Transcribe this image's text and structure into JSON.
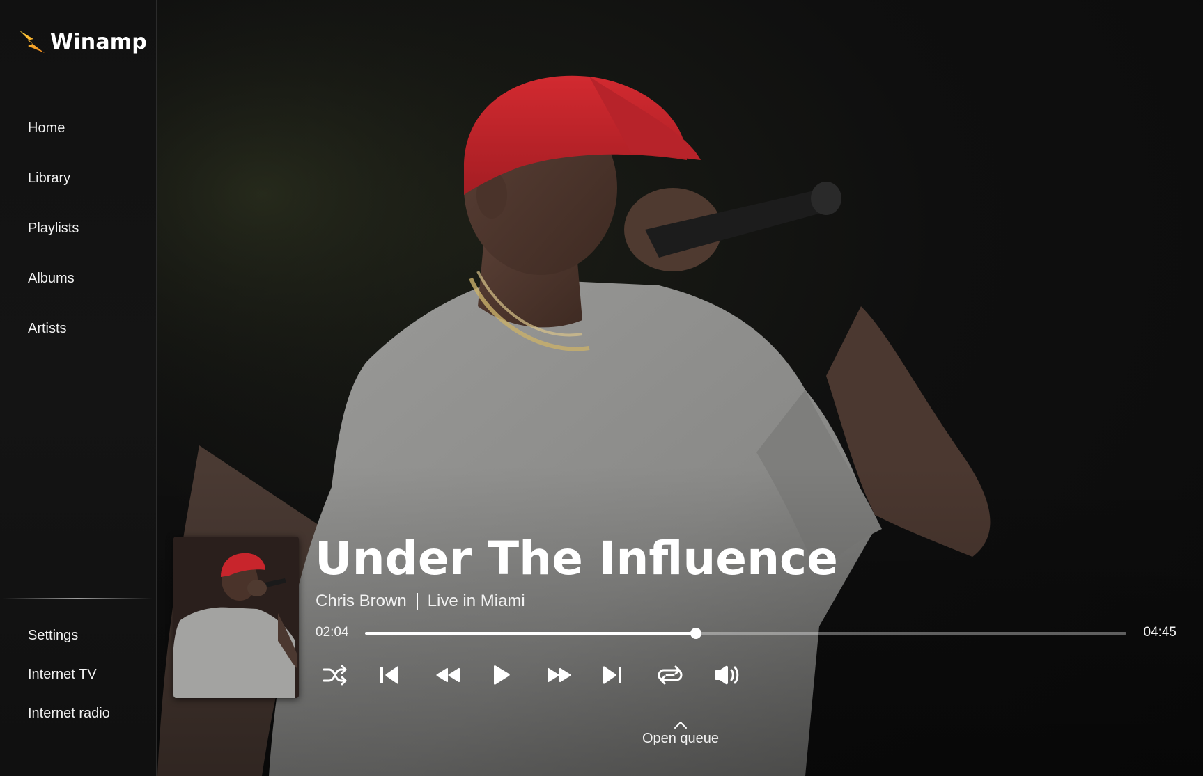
{
  "app": {
    "name": "Winamp"
  },
  "sidebar": {
    "primary": [
      {
        "label": "Home",
        "icon": "home"
      },
      {
        "label": "Library",
        "icon": "library"
      },
      {
        "label": "Playlists",
        "icon": "playlists"
      },
      {
        "label": "Albums",
        "icon": "albums"
      },
      {
        "label": "Artists",
        "icon": "artists"
      }
    ],
    "secondary": [
      {
        "label": "Settings",
        "icon": "settings"
      },
      {
        "label": "Internet TV",
        "icon": "internet-tv"
      },
      {
        "label": "Internet radio",
        "icon": "internet-radio"
      }
    ]
  },
  "now_playing": {
    "title": "Under The Influence",
    "artist": "Chris Brown",
    "album": "Live in Miami",
    "current_time": "02:04",
    "total_time": "04:45",
    "progress_fraction": 0.435
  },
  "controls": [
    {
      "name": "shuffle",
      "icon": "shuffle-icon"
    },
    {
      "name": "previous-track",
      "icon": "skip-previous-icon"
    },
    {
      "name": "rewind",
      "icon": "rewind-icon"
    },
    {
      "name": "play",
      "icon": "play-icon"
    },
    {
      "name": "fast-forward",
      "icon": "fast-forward-icon"
    },
    {
      "name": "next-track",
      "icon": "skip-next-icon"
    },
    {
      "name": "repeat",
      "icon": "repeat-icon"
    },
    {
      "name": "volume",
      "icon": "volume-icon"
    }
  ],
  "queue": {
    "label": "Open queue"
  },
  "colors": {
    "accent_bolt_top": "#ffd23c",
    "accent_bolt_bottom": "#f28a1e",
    "cap_red": "#c8252c",
    "shirt": "#8e8e8e",
    "background": "#0e0e0e"
  }
}
